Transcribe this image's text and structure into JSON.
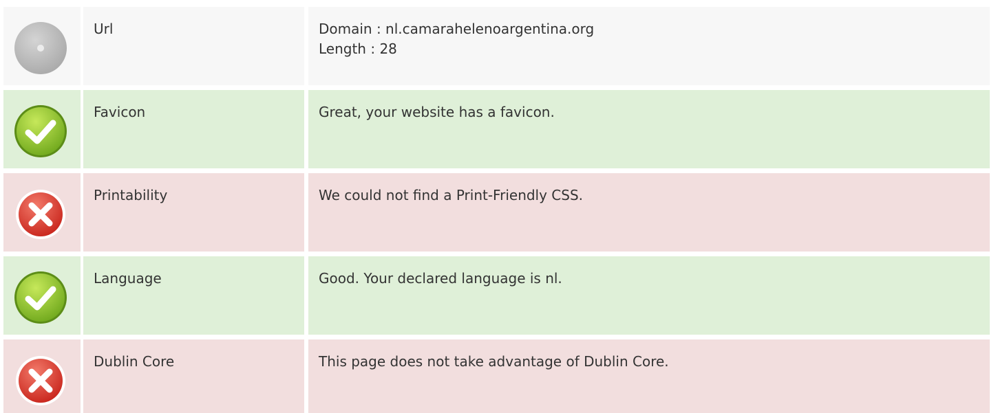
{
  "colors": {
    "neutral_bg": "#f7f7f7",
    "pass_bg": "#dff0d8",
    "fail_bg": "#f2dede",
    "text": "#333333"
  },
  "rows": [
    {
      "status": "neutral",
      "icon": "neutral-circle-icon",
      "label": "Url",
      "value_lines": [
        "Domain : nl.camarahelenoargentina.org",
        "Length : 28"
      ]
    },
    {
      "status": "pass",
      "icon": "check-circle-icon",
      "label": "Favicon",
      "value_lines": [
        "Great, your website has a favicon."
      ]
    },
    {
      "status": "fail",
      "icon": "x-circle-icon",
      "label": "Printability",
      "value_lines": [
        "We could not find a Print-Friendly CSS."
      ]
    },
    {
      "status": "pass",
      "icon": "check-circle-icon",
      "label": "Language",
      "value_lines": [
        "Good. Your declared language is nl."
      ]
    },
    {
      "status": "fail",
      "icon": "x-circle-icon",
      "label": "Dublin Core",
      "value_lines": [
        "This page does not take advantage of Dublin Core."
      ]
    }
  ]
}
